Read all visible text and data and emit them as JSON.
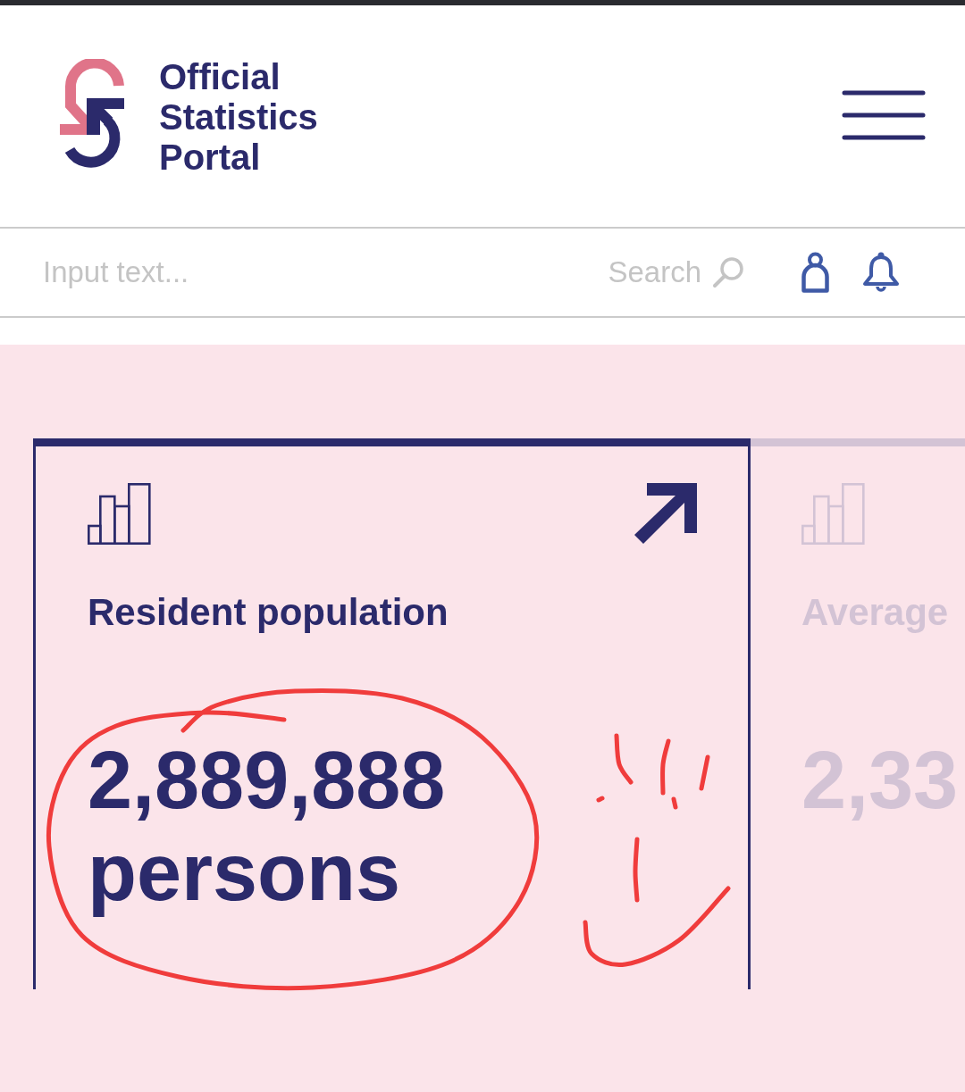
{
  "header": {
    "title": "Official Statistics Portal"
  },
  "search": {
    "placeholder": "Input text...",
    "button": "Search"
  },
  "cards": [
    {
      "title": "Resident population",
      "value": "2,889,888 persons",
      "selected": true
    },
    {
      "title": "Average",
      "value": "2,33",
      "selected": false
    }
  ]
}
